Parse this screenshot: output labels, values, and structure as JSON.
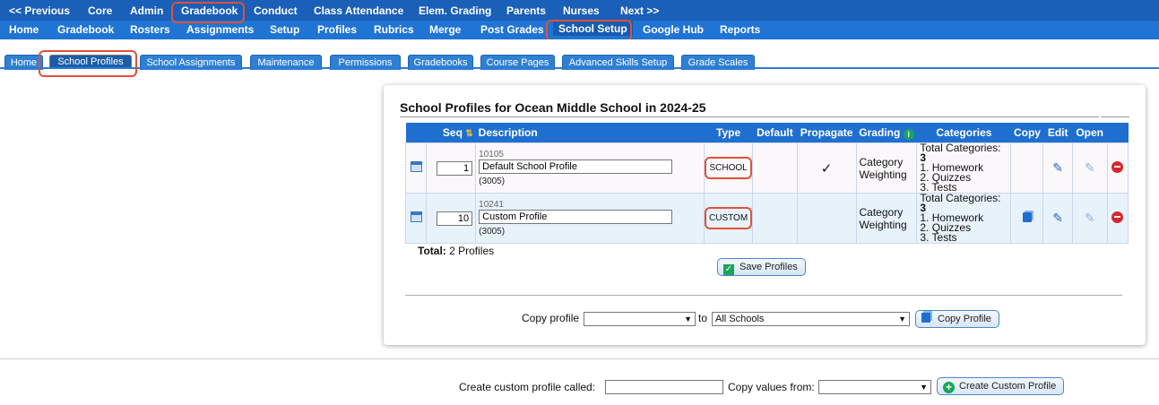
{
  "nav_top": [
    "<< Previous",
    "Core",
    "Admin",
    "Gradebook",
    "Conduct",
    "Class Attendance",
    "Elem. Grading",
    "Parents",
    "Nurses",
    "Next >>"
  ],
  "nav_sub": [
    "Home",
    "Gradebook",
    "Rosters",
    "Assignments",
    "Setup",
    "Profiles",
    "Rubrics",
    "Merge",
    "Post Grades",
    "School Setup",
    "Google Hub",
    "Reports"
  ],
  "tabs": [
    "Home",
    "School Profiles",
    "School Assignments",
    "Maintenance",
    "Permissions",
    "Gradebooks",
    "Course Pages",
    "Advanced Skills Setup",
    "Grade Scales"
  ],
  "panel": {
    "title": "School Profiles for Ocean Middle School in 2024-25",
    "columns": {
      "seq": "Seq",
      "description": "Description",
      "type": "Type",
      "default": "Default",
      "propagate": "Propagate",
      "grading": "Grading",
      "categories": "Categories",
      "copy": "Copy",
      "edit": "Edit",
      "open": "Open"
    },
    "rows": [
      {
        "seq": "1",
        "code": "10105",
        "description": "Default School Profile",
        "count": "(3005)",
        "type": "SCHOOL",
        "propagate": "✓",
        "grading1": "Category",
        "grading2": "Weighting",
        "cat_total_label": "Total Categories: ",
        "cat_total": "3",
        "cat1": "1. Homework",
        "cat2": "2. Quizzes",
        "cat3": "3. Tests"
      },
      {
        "seq": "10",
        "code": "10241",
        "description": "Custom Profile",
        "count": "(3005)",
        "type": "CUSTOM",
        "propagate": "",
        "grading1": "Category",
        "grading2": "Weighting",
        "cat_total_label": "Total Categories: ",
        "cat_total": "3",
        "cat1": "1. Homework",
        "cat2": "2. Quizzes",
        "cat3": "3. Tests"
      }
    ],
    "total_label": "Total:",
    "total_value": "2 Profiles",
    "save_button": "Save Profiles",
    "copy_profile_label": "Copy profile",
    "copy_to_label": "to",
    "copy_to_value": "All Schools",
    "copy_button": "Copy Profile"
  },
  "bottom": {
    "create_label": "Create custom profile called:",
    "copy_values_label": "Copy values from:",
    "create_button": "Create Custom Profile"
  },
  "colors": {
    "nav_top": "#1a5fb8",
    "nav_sub": "#1f74d4",
    "highlight": "#e0503a"
  }
}
